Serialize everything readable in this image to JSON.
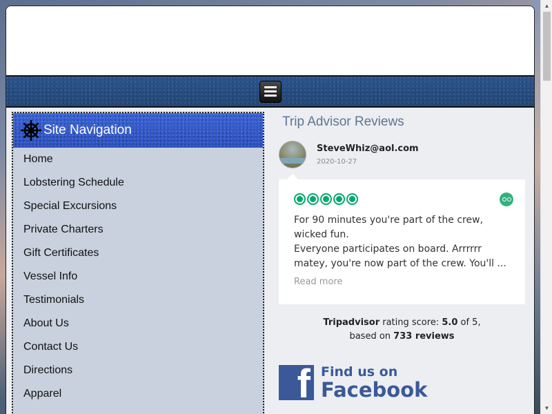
{
  "navbar": {
    "menu_icon": "hamburger-icon"
  },
  "sidebar": {
    "title": "Site Navigation",
    "icon": "ship-wheel-icon",
    "items": [
      {
        "label": "Home"
      },
      {
        "label": "Lobstering Schedule"
      },
      {
        "label": "Special Excursions"
      },
      {
        "label": "Private Charters"
      },
      {
        "label": "Gift Certificates"
      },
      {
        "label": "Vessel Info"
      },
      {
        "label": "Testimonials"
      },
      {
        "label": "About Us"
      },
      {
        "label": "Contact Us"
      },
      {
        "label": "Directions"
      },
      {
        "label": "Apparel"
      }
    ]
  },
  "reviews": {
    "title": "Trip Advisor Reviews",
    "reviewer_name": "SteveWhiz@aol.com",
    "review_date": "2020-10-27",
    "rating_bubbles": 5,
    "review_line1": "For 90 minutes you're part of the crew, wicked fun.",
    "review_line2": "Everyone participates on board. Arrrrrr matey, you're now part of the crew. You'll ...",
    "read_more": "Read more",
    "score_brand": "Tripadvisor",
    "score_text1": " rating score: ",
    "score_value": "5.0",
    "score_text2": " of 5,",
    "score_text3": "based on ",
    "score_reviews": "733 reviews"
  },
  "facebook": {
    "letter": "f",
    "line1": "Find us on",
    "line2": "Facebook"
  },
  "colors": {
    "brand_blue": "#2f55c8",
    "navbar_blue": "#284f86",
    "tripadvisor_green": "#00aa6c",
    "facebook_blue": "#3b5998"
  }
}
